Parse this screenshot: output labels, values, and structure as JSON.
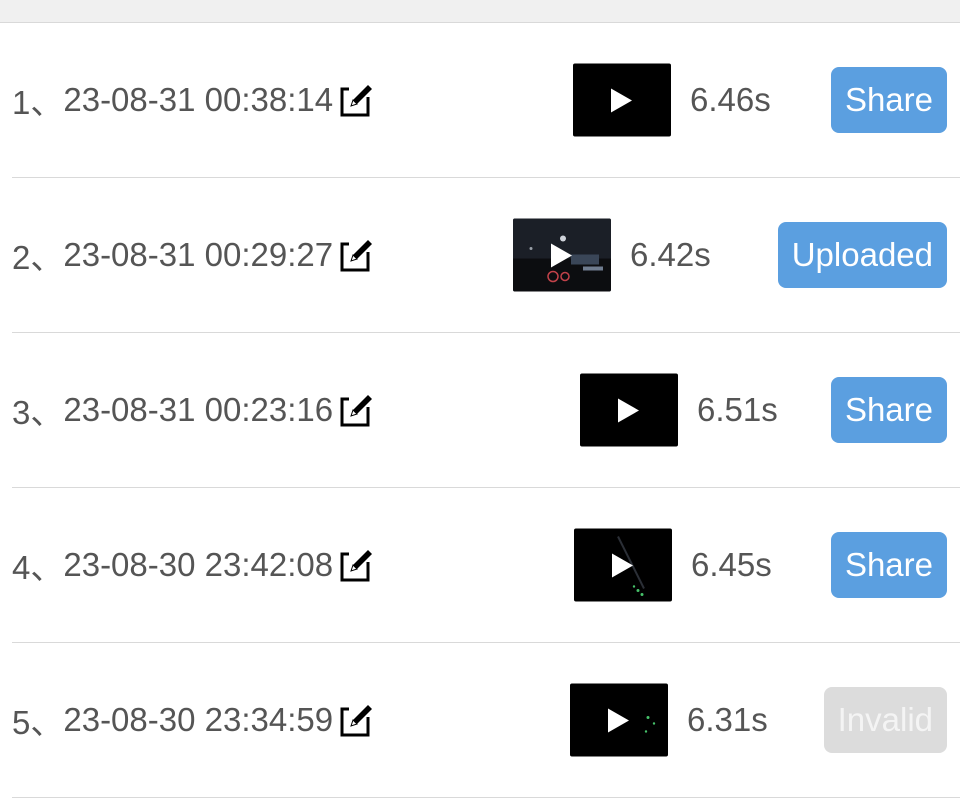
{
  "items": [
    {
      "index_label": "1、",
      "timestamp": "23-08-31 00:38:14",
      "duration": "6.46s",
      "action_label": "Share",
      "action_state": "share"
    },
    {
      "index_label": "2、",
      "timestamp": "23-08-31 00:29:27",
      "duration": "6.42s",
      "action_label": "Uploaded",
      "action_state": "uploaded"
    },
    {
      "index_label": "3、",
      "timestamp": "23-08-31 00:23:16",
      "duration": "6.51s",
      "action_label": "Share",
      "action_state": "share"
    },
    {
      "index_label": "4、",
      "timestamp": "23-08-30 23:42:08",
      "duration": "6.45s",
      "action_label": "Share",
      "action_state": "share"
    },
    {
      "index_label": "5、",
      "timestamp": "23-08-30 23:34:59",
      "duration": "6.31s",
      "action_label": "Invalid",
      "action_state": "invalid"
    }
  ],
  "icons": {
    "edit": "edit-icon",
    "play": "play-icon"
  },
  "colors": {
    "action_active": "#5b9fe0",
    "action_disabled": "#dcdcdc",
    "text": "#555555",
    "divider": "#d9d9d9"
  }
}
